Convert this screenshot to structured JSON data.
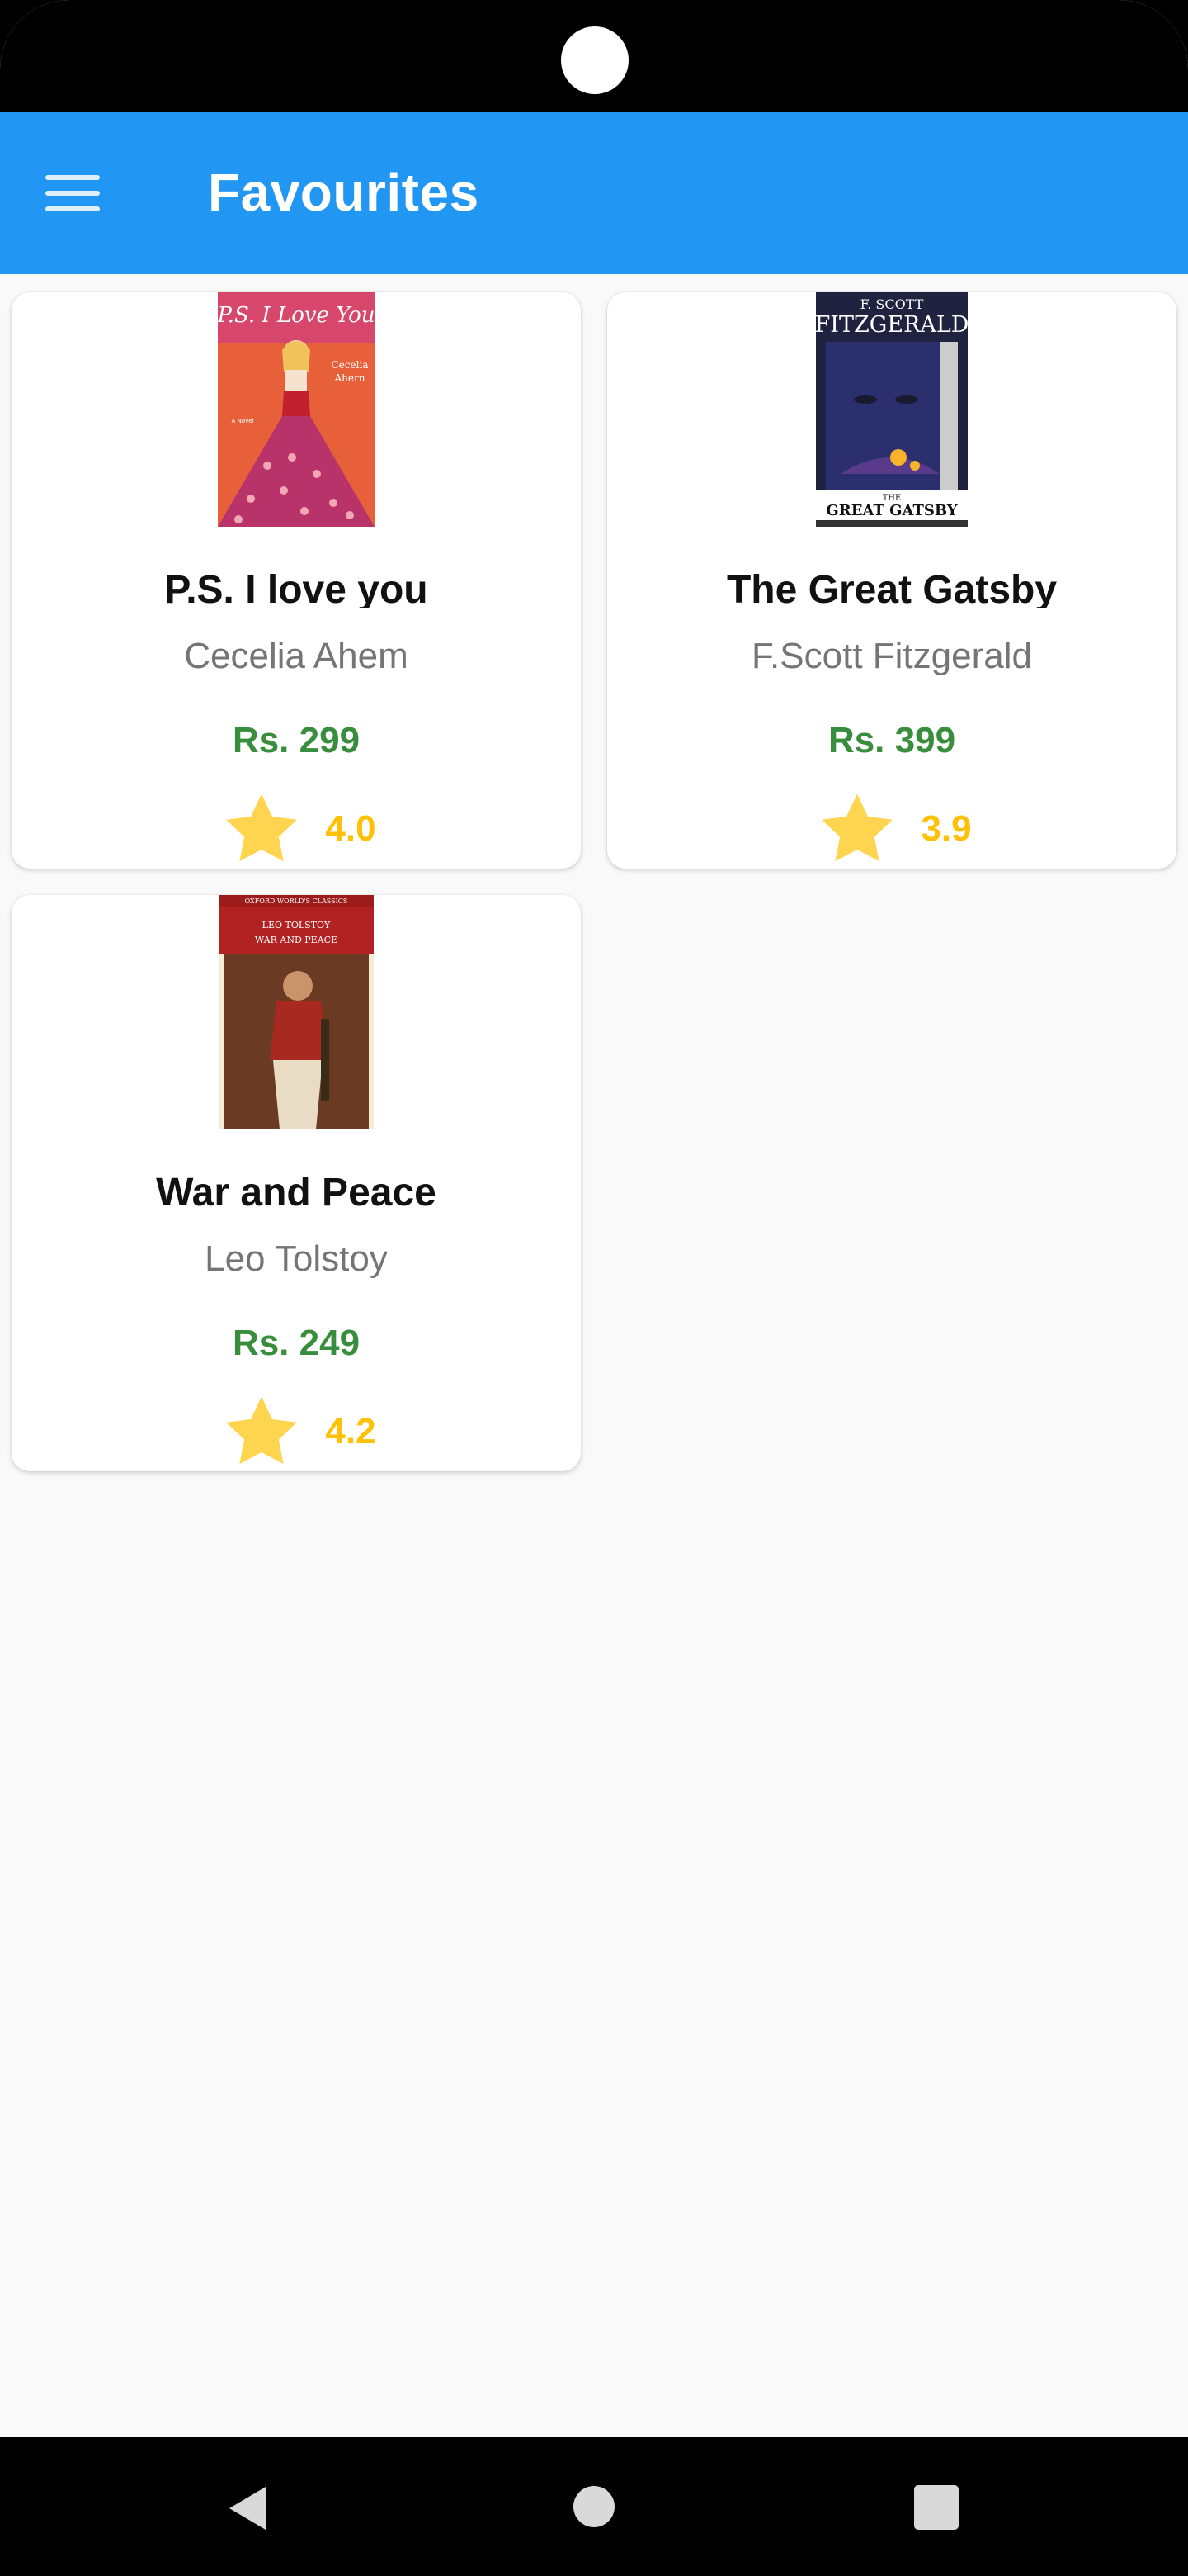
{
  "app_bar": {
    "title": "Favourites",
    "color": "#2196f3",
    "menu_icon": "hamburger-menu-icon"
  },
  "books": [
    {
      "title": "P.S. I love you",
      "author": "Cecelia Ahem",
      "price": "Rs. 299",
      "rating": "4.0",
      "cover_text": [
        "P.S. I Love You",
        "Cecelia",
        "Ahern",
        "A Novel"
      ]
    },
    {
      "title": "The Great Gatsby",
      "author": "F.Scott Fitzgerald",
      "price": "Rs. 399",
      "rating": "3.9",
      "cover_text": [
        "F. SCOTT",
        "FITZGERALD",
        "THE",
        "GREAT GATSBY"
      ]
    },
    {
      "title": "War and Peace",
      "author": "Leo Tolstoy",
      "price": "Rs. 249",
      "rating": "4.2",
      "cover_text": [
        "OXFORD WORLD'S CLASSICS",
        "LEO TOLSTOY",
        "WAR AND PEACE"
      ]
    }
  ],
  "colors": {
    "price": "#388e3c",
    "rating": "#ffc107",
    "star": "#ffd54f"
  },
  "nav": [
    "back-icon",
    "home-icon",
    "recents-icon"
  ]
}
